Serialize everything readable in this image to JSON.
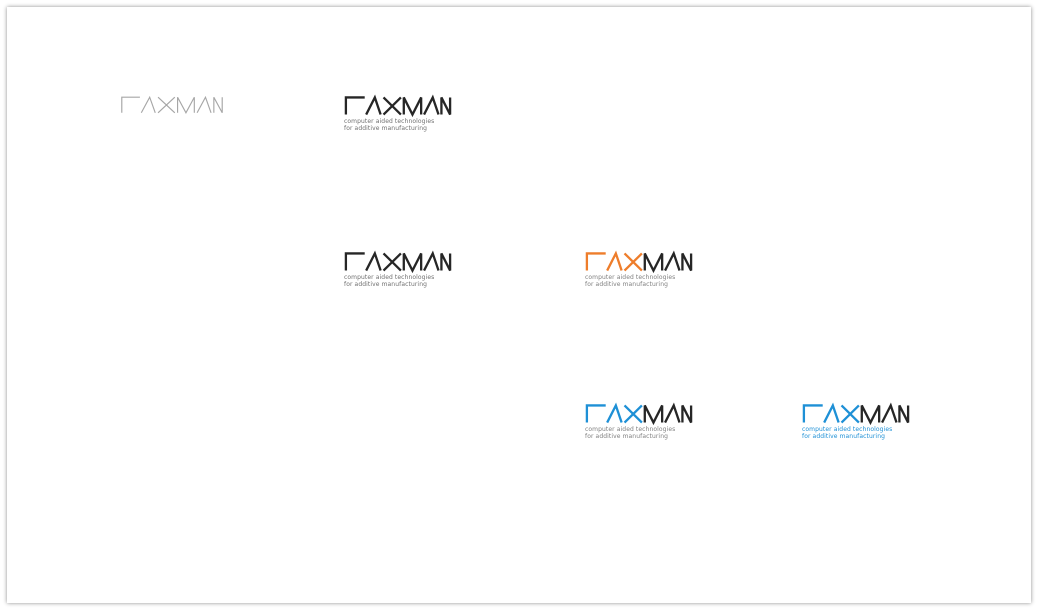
{
  "logos": [
    {
      "id": "wordmark-grey",
      "wordmark": "CAXMAN",
      "tagline": [],
      "color_cax": "#a6a6a6",
      "color_man": "#a6a6a6",
      "color_tagline": "#a6a6a6",
      "stroke": "thin"
    },
    {
      "id": "logo-black",
      "wordmark": "CAXMAN",
      "tagline": [
        "computer aided technologies",
        "for additive manufacturing"
      ],
      "color_cax": "#262626",
      "color_man": "#262626",
      "color_tagline": "#707070",
      "stroke": "bold"
    },
    {
      "id": "logo-black-2",
      "wordmark": "CAXMAN",
      "tagline": [
        "computer aided technologies",
        "for additive manufacturing"
      ],
      "color_cax": "#262626",
      "color_man": "#262626",
      "color_tagline": "#707070",
      "stroke": "bold"
    },
    {
      "id": "logo-orange",
      "wordmark": "CAXMAN",
      "tagline": [
        "computer aided technologies",
        "for additive manufacturing"
      ],
      "color_cax": "#ee7d2b",
      "color_man": "#262626",
      "color_tagline": "#808080",
      "stroke": "bold"
    },
    {
      "id": "logo-blue",
      "wordmark": "CAXMAN",
      "tagline": [
        "computer aided technologies",
        "for additive manufacturing"
      ],
      "color_cax": "#1e90d6",
      "color_man": "#262626",
      "color_tagline": "#808080",
      "stroke": "bold"
    },
    {
      "id": "logo-blue-tagline",
      "wordmark": "CAXMAN",
      "tagline": [
        "computer aided technologies",
        "for additive manufacturing"
      ],
      "color_cax": "#1e90d6",
      "color_man": "#262626",
      "color_tagline": "#1e90d6",
      "stroke": "bold"
    }
  ]
}
